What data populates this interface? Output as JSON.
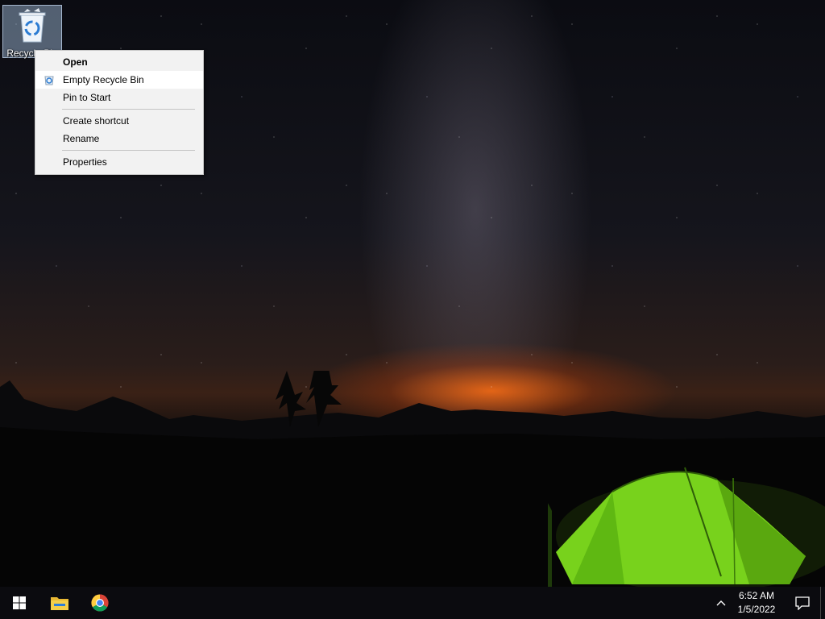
{
  "desktop": {
    "icons": [
      {
        "label": "Recycle Bin",
        "icon": "recycle-bin-icon"
      }
    ]
  },
  "context_menu": {
    "items": [
      {
        "label": "Open"
      },
      {
        "label": "Empty Recycle Bin",
        "icon": "recycle-bin-icon"
      },
      {
        "label": "Pin to Start"
      },
      {
        "label": "Create shortcut"
      },
      {
        "label": "Rename"
      },
      {
        "label": "Properties"
      }
    ]
  },
  "taskbar": {
    "pinned": [
      {
        "icon": "windows-start-icon"
      },
      {
        "icon": "file-explorer-icon"
      },
      {
        "icon": "chrome-icon"
      }
    ],
    "clock": {
      "time": "6:52 AM",
      "date": "1/5/2022"
    },
    "tray": {
      "chevron_icon": "chevron-up-icon",
      "notification_icon": "action-center-icon"
    }
  },
  "colors": {
    "taskbar": "#0b0b0f",
    "menu_bg": "#f2f2f2",
    "tent_green": "#7ddc1f"
  }
}
